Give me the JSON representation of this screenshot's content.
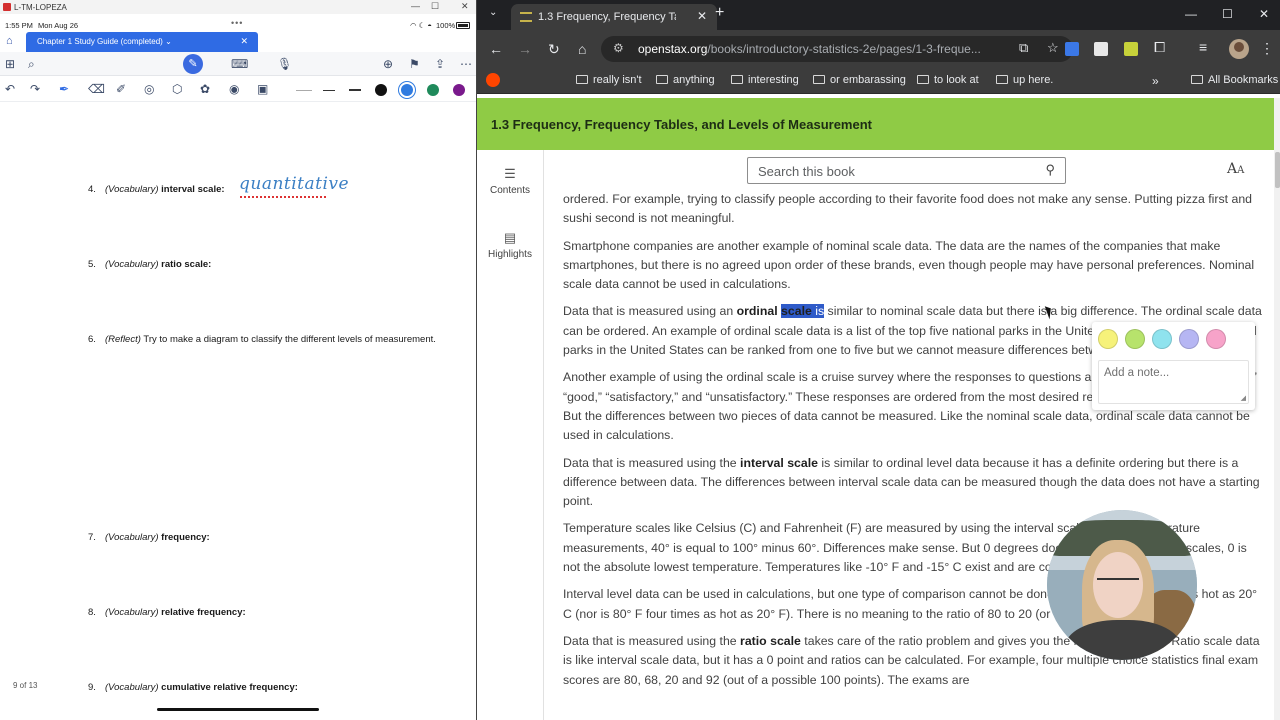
{
  "notes_app": {
    "window_title": "L-TM-LOPEZA",
    "status": {
      "time": "1:55 PM",
      "date": "Mon Aug 26",
      "battery": "100%"
    },
    "tab_label": "Chapter 1 Study Guide (completed)",
    "questions": [
      {
        "num": "4.",
        "type": "(Vocabulary)",
        "term": "interval scale:"
      },
      {
        "num": "5.",
        "type": "(Vocabulary)",
        "term": "ratio scale:"
      },
      {
        "num": "6.",
        "type": "(Reflect)",
        "term": "Try to make a diagram to classify the different levels of measurement."
      },
      {
        "num": "7.",
        "type": "(Vocabulary)",
        "term": "frequency:"
      },
      {
        "num": "8.",
        "type": "(Vocabulary)",
        "term": "relative frequency:"
      },
      {
        "num": "9.",
        "type": "(Vocabulary)",
        "term": "cumulative relative frequency:"
      }
    ],
    "handwritten_answer": "quantitative",
    "page_indicator": "9 of 13",
    "pen_colors": [
      "#111111",
      "#2f7be0",
      "#1f8a5b",
      "#7a1a8c"
    ]
  },
  "browser": {
    "tab_title": "1.3 Frequency, Frequency Table",
    "url_host": "openstax.org",
    "url_path": "/books/introductory-statistics-2e/pages/1-3-freque...",
    "bookmarks": [
      "There",
      "really isn't",
      "anything",
      "interesting",
      "or embarassing",
      "to look at",
      "up here."
    ],
    "all_bookmarks": "All Bookmarks",
    "extension_colors": [
      "#3b78e7",
      "#e8e8e8",
      "#c7d23a",
      "#e8eaed"
    ]
  },
  "page": {
    "section_title": "1.3 Frequency, Frequency Tables, and Levels of Measurement",
    "sidebar": {
      "contents": "Contents",
      "highlights": "Highlights"
    },
    "search_placeholder": "Search this book",
    "paragraphs": {
      "p1": "ordered. For example, trying to classify people according to their favorite food does not make any sense. Putting pizza first and sushi second is not meaningful.",
      "p2": "Smartphone companies are another example of nominal scale data. The data are the names of the companies that make smartphones, but there is no agreed upon order of these brands, even though people may have personal preferences. Nominal scale data cannot be used in calculations.",
      "p3_a": "Data that is measured using an ",
      "p3_b": "ordinal",
      "p3_c": "scale",
      "p3_d": " is",
      "p3_e": " similar to nominal scale data but there is a big difference. The ordinal scale data can be ordered. An example of ordinal scale data is a list of the top five national parks in the United States. The top five national parks in the United States can be ranked from one to five but we cannot measure differences between the data.",
      "p4": "Another example of using the ordinal scale is a cruise survey where the responses to questions about the cruise are “excellent,” “good,” “satisfactory,” and “unsatisfactory.” These responses are ordered from the most desired response to the least desired. But the differences between two pieces of data cannot be measured. Like the nominal scale data, ordinal scale data cannot be used in calculations.",
      "p5_a": "Data that is measured using the ",
      "p5_b": "interval scale",
      "p5_c": " is similar to ordinal level data because it has a definite ordering but there is a difference between data. The differences between interval scale data can be measured though the data does not have a starting point.",
      "p6": "Temperature scales like Celsius (C) and Fahrenheit (F) are measured by using the interval scale. In both temperature measurements, 40° is equal to 100° minus 60°. Differences make sense. But 0 degrees does not because, in both scales, 0 is not the absolute lowest temperature. Temperatures like -10° F and -15° C exist and are colder than 0.",
      "p7": "Interval level data can be used in calculations, but one type of comparison cannot be done. 80° C is not four times as hot as 20° C (nor is 80° F four times as hot as 20° F). There is no meaning to the ratio of 80 to 20 (or four to one).",
      "p8_a": "Data that is measured using the ",
      "p8_b": "ratio scale",
      "p8_c": " takes care of the ratio problem and gives you the most information. Ratio scale data is like interval scale data, but it has a 0 point and ratios can be calculated. For example, four multiple choice statistics final exam scores are 80, 68, 20 and 92 (out of a possible 100 points). The exams are"
    },
    "highlight_popup": {
      "colors": [
        "#f6f27a",
        "#b7e36c",
        "#8fe3ee",
        "#b6b6f3",
        "#f7a3c9"
      ],
      "note_placeholder": "Add a note..."
    }
  }
}
